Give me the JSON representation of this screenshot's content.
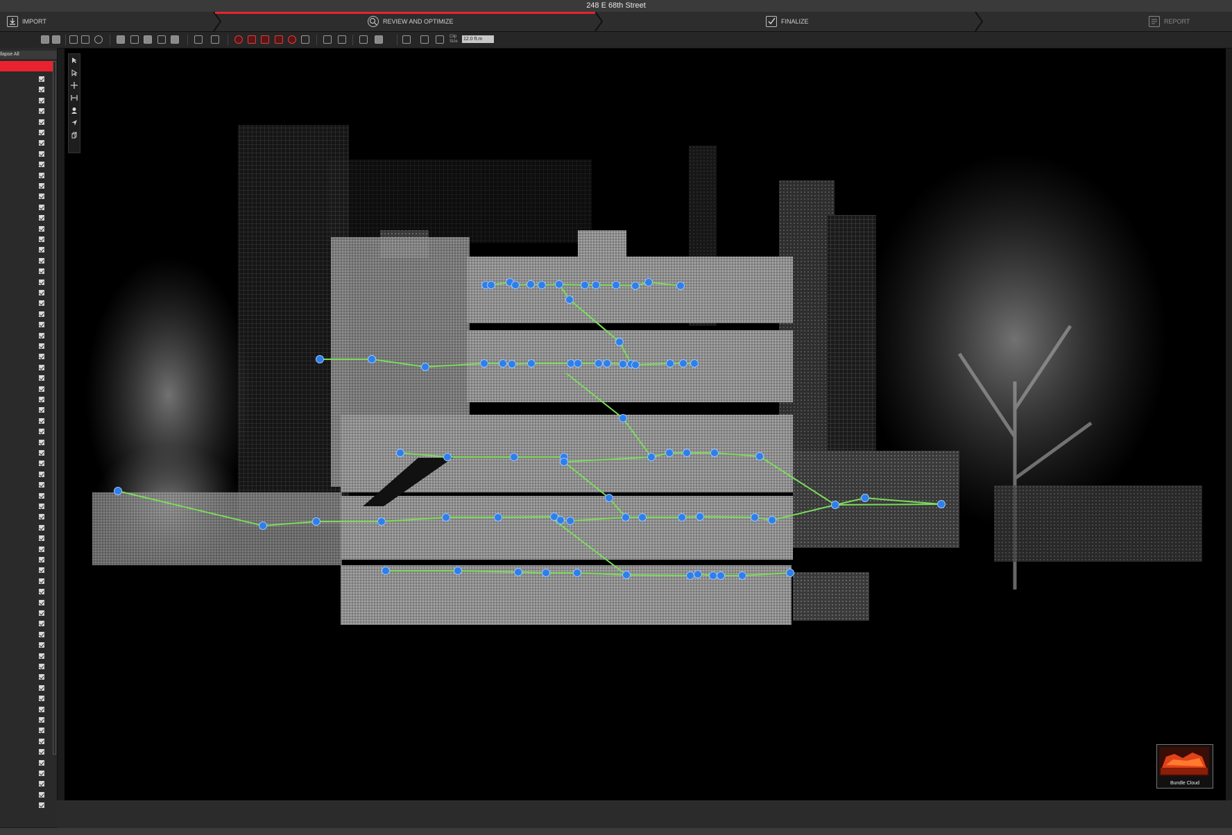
{
  "window": {
    "title": "248 E 68th Street"
  },
  "workflow": {
    "steps": [
      {
        "label": "IMPORT",
        "icon": "import-icon"
      },
      {
        "label": "REVIEW AND OPTIMIZE",
        "icon": "review-icon"
      },
      {
        "label": "FINALIZE",
        "icon": "finalize-icon"
      },
      {
        "label": "REPORT",
        "icon": "report-icon"
      }
    ],
    "active_step": "REVIEW AND OPTIMIZE"
  },
  "toolbar": {
    "snap_label": "Clip Size",
    "snap_value": "12.0 ft.m"
  },
  "left_panel": {
    "collapse_all": "llapse All"
  },
  "viewport": {
    "thumbnail_label": "Bundle Cloud"
  },
  "colors": {
    "accent": "#e8232f",
    "scan_node": "#2f7fe8",
    "link_line": "#7bdc5a",
    "background": "#000000"
  }
}
